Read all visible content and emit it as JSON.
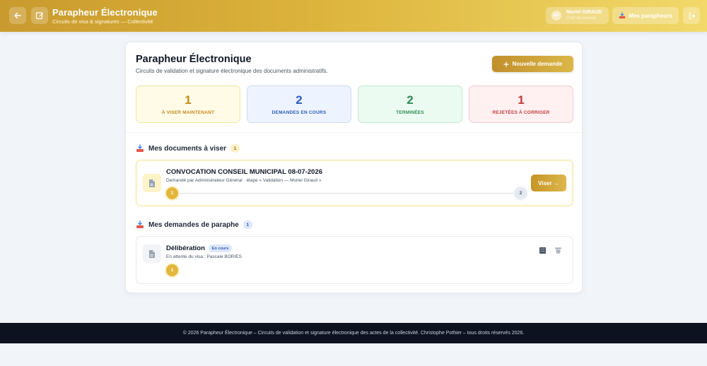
{
  "header": {
    "title": "Parapheur Électronique",
    "subtitle": "Circuits de visa & signatures — Collectivité",
    "user": {
      "initials": "MG",
      "name": "Muriel GIRAUD",
      "role": "Chef de service"
    },
    "parapheurs_label": "Mes parapheurs",
    "icons": [
      "back-arrow-icon",
      "edit-icon",
      "logout-icon"
    ]
  },
  "page": {
    "title": "Parapheur Électronique",
    "subtitle": "Circuits de validation et signature électronique des documents administratifs.",
    "new_request_label": "Nouvelle demande"
  },
  "stats": [
    {
      "value": "1",
      "label": "À VISER MAINTENANT",
      "color": "#c28a1e"
    },
    {
      "value": "2",
      "label": "DEMANDES EN COURS",
      "color": "#2b5bb8"
    },
    {
      "value": "2",
      "label": "TERMINÉES",
      "color": "#2d8a57"
    },
    {
      "value": "1",
      "label": "REJETÉES À CORRIGER",
      "color": "#c23a3a"
    }
  ],
  "to_sign": {
    "title": "Mes documents à viser",
    "count": "1",
    "items": [
      {
        "title": "CONVOCATION CONSEIL MUNICIPAL 08-07-2026",
        "meta": "Demandé par Administrateur Général · étape « Validation — Muriel Giraud »",
        "steps": [
          "1",
          "2"
        ],
        "current_step": 1,
        "action_label": "Viser →"
      }
    ]
  },
  "my_requests": {
    "title": "Mes demandes de paraphe",
    "count": "1",
    "items": [
      {
        "title": "Délibération",
        "status": "En cours",
        "meta": "En attente du visa : Pascale BORIES",
        "steps": [
          "1"
        ]
      }
    ]
  },
  "footer": {
    "text": "© 2026 Parapheur Électronique – Circuits de validation et signature électronique des actes de la collectivité. Christophe Pothier – tous droits réservés 2026."
  }
}
